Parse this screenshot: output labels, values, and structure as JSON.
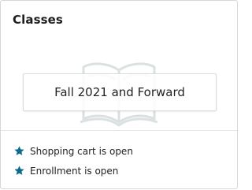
{
  "card": {
    "title": "Classes",
    "term_button_label": "Fall 2021 and Forward",
    "watermark_icon": "open-book-icon"
  },
  "status": [
    {
      "icon": "star-icon",
      "text": "Shopping cart is open"
    },
    {
      "icon": "star-icon",
      "text": "Enrollment is open"
    }
  ],
  "colors": {
    "accent_star": "#0e6a8a",
    "watermark": "#9aa7ad"
  }
}
